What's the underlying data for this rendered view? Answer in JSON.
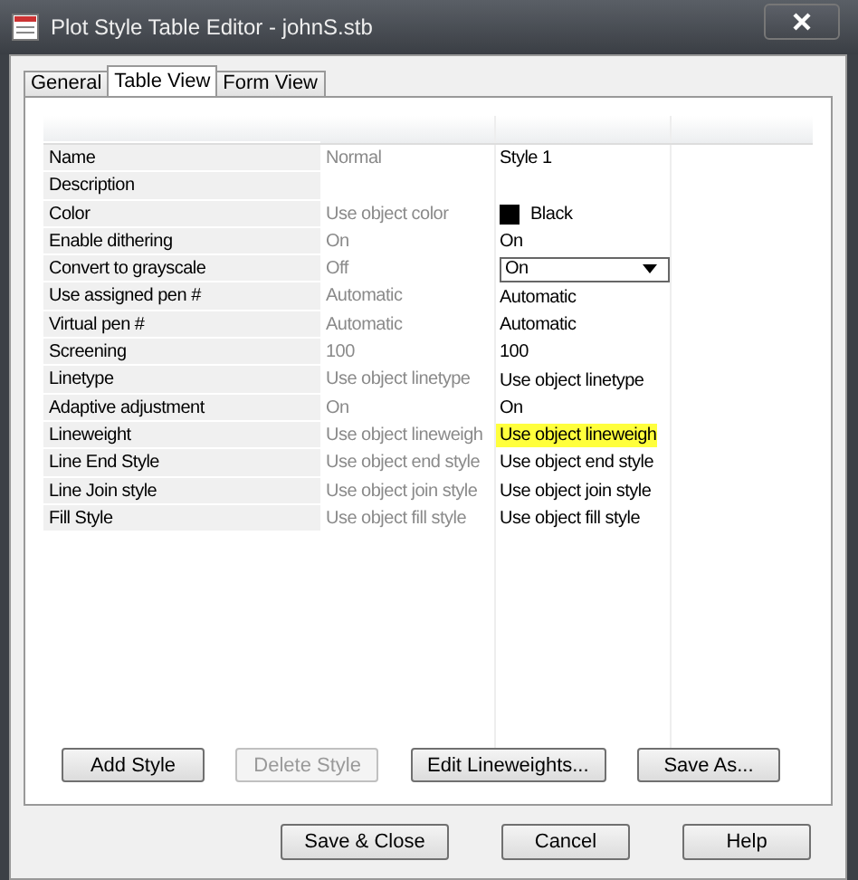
{
  "window": {
    "title": "Plot Style Table Editor - johnS.stb"
  },
  "tabs": [
    {
      "label": "General",
      "selected": false
    },
    {
      "label": "Table View",
      "selected": true
    },
    {
      "label": "Form View",
      "selected": false
    }
  ],
  "table": {
    "rows": [
      {
        "label": "Name",
        "default": "Normal",
        "value": "Style 1",
        "kind": "text"
      },
      {
        "label": "Description",
        "kind": "text"
      },
      {
        "label": "Color",
        "default": "Use object color",
        "value": "Black",
        "kind": "color",
        "color": "#000000"
      },
      {
        "label": "Enable dithering",
        "default": "On",
        "value": "On",
        "kind": "text"
      },
      {
        "label": "Convert to grayscale",
        "default": "Off",
        "value": "On",
        "kind": "dropdown"
      },
      {
        "label": "Use assigned pen #",
        "default": "Automatic",
        "value": "Automatic",
        "kind": "text"
      },
      {
        "label": "Virtual pen #",
        "default": "Automatic",
        "value": "Automatic",
        "kind": "text"
      },
      {
        "label": "Screening",
        "default": "100",
        "value": "100",
        "kind": "text"
      },
      {
        "label": "Linetype",
        "default": "Use object linetype",
        "value": "Use object linetype",
        "kind": "text"
      },
      {
        "label": "Adaptive adjustment",
        "default": "On",
        "value": "On",
        "kind": "text"
      },
      {
        "label": "Lineweight",
        "default": "Use object lineweigh",
        "value": "Use object lineweigh",
        "kind": "text",
        "highlighted": true
      },
      {
        "label": "Line End Style",
        "default": "Use object end style",
        "value": "Use object end style",
        "kind": "text"
      },
      {
        "label": "Line Join style",
        "default": "Use object join style",
        "value": "Use object join style",
        "kind": "text"
      },
      {
        "label": "Fill Style",
        "default": "Use object fill style",
        "value": "Use object fill style",
        "kind": "text"
      }
    ]
  },
  "panel_buttons": [
    {
      "label": "Add Style",
      "disabled": false
    },
    {
      "label": "Delete Style",
      "disabled": true
    },
    {
      "label": "Edit Lineweights...",
      "disabled": false
    },
    {
      "label": "Save As...",
      "disabled": false
    }
  ],
  "dialog_buttons": [
    "Save & Close",
    "Cancel",
    "Help"
  ]
}
